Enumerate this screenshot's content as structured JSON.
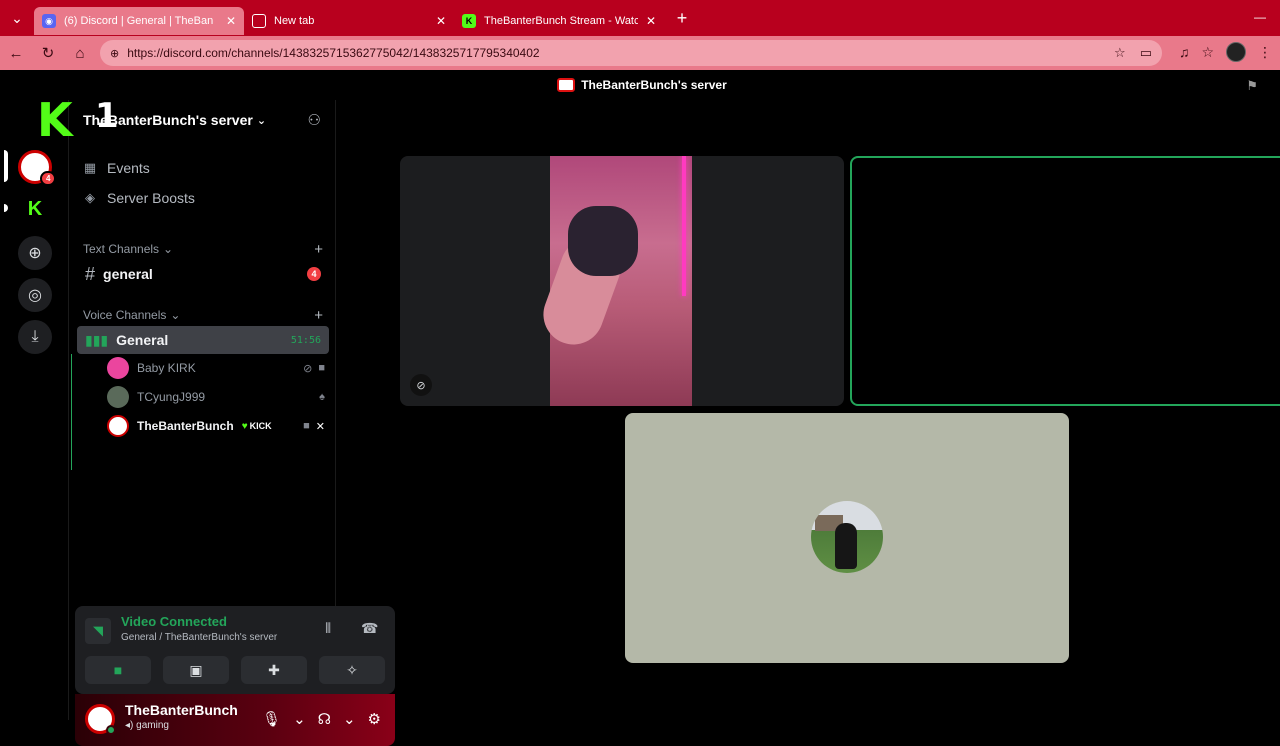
{
  "browser": {
    "tabs": [
      {
        "title": "(6) Discord | General | TheBan",
        "active": true,
        "favicon": "discord-icon"
      },
      {
        "title": "New tab",
        "active": false,
        "favicon": "newtab-icon"
      },
      {
        "title": "TheBanterBunch Stream - Watch L",
        "active": false,
        "favicon": "kick-icon"
      }
    ],
    "url": "https://discord.com/channels/1438325715362775042/1438325717795340402"
  },
  "discord": {
    "topbar_title": "TheBanterBunch's server",
    "server_name": "TheBanterBunch's server",
    "overlay": {
      "logo": "K",
      "number": "1"
    },
    "guild_badge": "4",
    "nav": {
      "events": "Events",
      "server_boosts": "Server Boosts"
    },
    "text_category": "Text Channels",
    "text_channel": {
      "name": "general",
      "mentions": "4"
    },
    "voice_category": "Voice Channels",
    "voice_channel": {
      "name": "General",
      "elapsed": "51:56"
    },
    "voice_users": [
      {
        "name": "Baby KIRK"
      },
      {
        "name": "TCyungJ999"
      },
      {
        "name": "TheBanterBunch",
        "tag": "KICK"
      }
    ],
    "connection": {
      "status": "Video Connected",
      "location": "General / TheBanterBunch's server"
    },
    "user": {
      "name": "TheBanterBunch",
      "activity": "gaming"
    }
  },
  "colors": {
    "accent_green": "#23a55a",
    "browser_red": "#b8001e",
    "kick_green": "#53fc18"
  }
}
